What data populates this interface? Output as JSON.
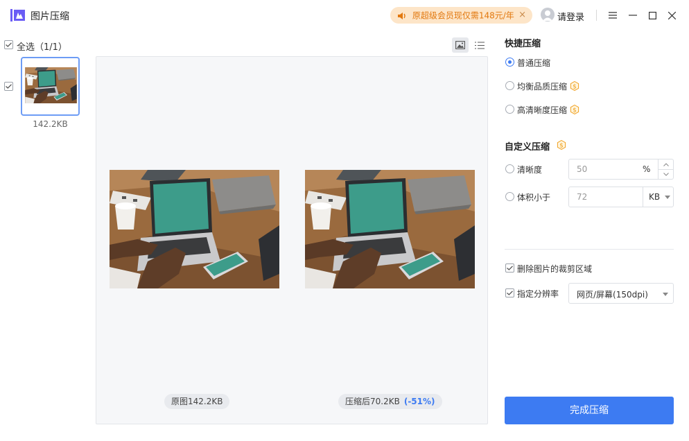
{
  "app": {
    "title": "图片压缩"
  },
  "promo": {
    "text": "原超级会员现仅需148元/年",
    "close": "×"
  },
  "account": {
    "login": "请登录"
  },
  "left": {
    "select_all": "全选（1/1）",
    "thumb_size": "142.2KB"
  },
  "preview": {
    "original_label": "原图142.2KB",
    "compressed_label": "压缩后70.2KB",
    "reduction": "(-51%)"
  },
  "quick": {
    "heading": "快捷压缩",
    "options": [
      {
        "label": "普通压缩",
        "selected": true,
        "vip": false
      },
      {
        "label": "均衡品质压缩",
        "selected": false,
        "vip": true
      },
      {
        "label": "高清晰度压缩",
        "selected": false,
        "vip": true
      }
    ]
  },
  "custom": {
    "heading": "自定义压缩",
    "clarity": {
      "label": "清晰度",
      "value": "50",
      "unit": "%"
    },
    "size": {
      "label": "体积小于",
      "value": "72",
      "unit": "KB"
    }
  },
  "options": {
    "crop": {
      "label": "删除图片的裁剪区域",
      "checked": true
    },
    "dpi": {
      "label": "指定分辨率",
      "checked": true,
      "value": "网页/屏幕(150dpi)"
    }
  },
  "done_button": "完成压缩",
  "colors": {
    "accent": "#3d7bf2",
    "promo_bg": "#fde5c8",
    "promo_text": "#e2780e",
    "vip_badge": "#f0a020"
  }
}
